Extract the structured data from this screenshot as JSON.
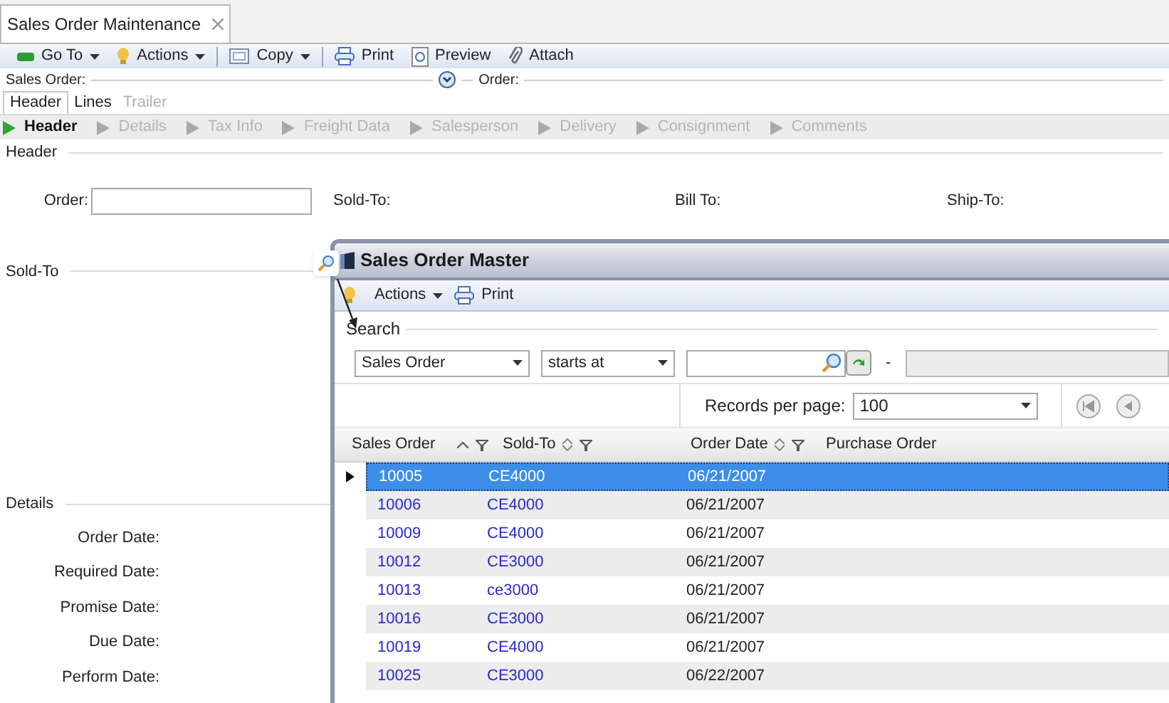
{
  "document_tab": {
    "title": "Sales Order Maintenance"
  },
  "toolbar": [
    {
      "label": "Go To",
      "kind": "goto"
    },
    {
      "label": "Actions",
      "kind": "actions"
    },
    {
      "label": "Copy",
      "kind": "copy"
    },
    {
      "label": "Print",
      "kind": "print"
    },
    {
      "label": "Preview",
      "kind": "preview"
    },
    {
      "label": "Attach",
      "kind": "attach"
    }
  ],
  "lookup_bar": {
    "sales_order_label": "Sales Order:",
    "order_label": "Order:"
  },
  "tabs": [
    {
      "label": "Header",
      "selected": true,
      "disabled": false
    },
    {
      "label": "Lines",
      "selected": false,
      "disabled": false
    },
    {
      "label": "Trailer",
      "selected": false,
      "disabled": true
    }
  ],
  "steps": [
    {
      "label": "Header",
      "selected": true
    },
    {
      "label": "Details",
      "selected": false
    },
    {
      "label": "Tax Info",
      "selected": false
    },
    {
      "label": "Freight Data",
      "selected": false
    },
    {
      "label": "Salesperson",
      "selected": false
    },
    {
      "label": "Delivery",
      "selected": false
    },
    {
      "label": "Consignment",
      "selected": false
    },
    {
      "label": "Comments",
      "selected": false
    }
  ],
  "header_group": {
    "title": "Header",
    "order_label": "Order:",
    "sold_to_label": "Sold-To:",
    "bill_to_label": "Bill To:",
    "ship_to_label": "Ship-To:"
  },
  "sold_to_group": {
    "title": "Sold-To"
  },
  "details_group": {
    "title": "Details",
    "fields": [
      "Order Date:",
      "Required Date:",
      "Promise Date:",
      "Due Date:",
      "Perform Date:"
    ]
  },
  "master_window": {
    "title": "Sales Order Master",
    "toolbar": [
      {
        "label": "Actions",
        "kind": "actions"
      },
      {
        "label": "Print",
        "kind": "print"
      }
    ],
    "search": {
      "title": "Search",
      "field": "Sales Order",
      "operator": "starts at",
      "separator": "-",
      "records_label": "Records per page:",
      "records_value": "100"
    },
    "columns": [
      {
        "label": "Sales Order",
        "sortable": true,
        "sorted": true,
        "filter": true
      },
      {
        "label": "Sold-To",
        "sortable": true,
        "sorted": false,
        "filter": true
      },
      {
        "label": "Order Date",
        "sortable": true,
        "sorted": false,
        "filter": true
      },
      {
        "label": "Purchase Order",
        "sortable": false,
        "filter": false
      }
    ],
    "rows": [
      {
        "sales_order": "10005",
        "sold_to": "CE4000",
        "order_date": "06/21/2007",
        "selected": true
      },
      {
        "sales_order": "10006",
        "sold_to": "CE4000",
        "order_date": "06/21/2007",
        "selected": false
      },
      {
        "sales_order": "10009",
        "sold_to": "CE4000",
        "order_date": "06/21/2007",
        "selected": false
      },
      {
        "sales_order": "10012",
        "sold_to": "CE3000",
        "order_date": "06/21/2007",
        "selected": false
      },
      {
        "sales_order": "10013",
        "sold_to": "ce3000",
        "order_date": "06/21/2007",
        "selected": false
      },
      {
        "sales_order": "10016",
        "sold_to": "CE3000",
        "order_date": "06/21/2007",
        "selected": false
      },
      {
        "sales_order": "10019",
        "sold_to": "CE4000",
        "order_date": "06/21/2007",
        "selected": false
      },
      {
        "sales_order": "10025",
        "sold_to": "CE3000",
        "order_date": "06/22/2007",
        "selected": false
      }
    ]
  }
}
